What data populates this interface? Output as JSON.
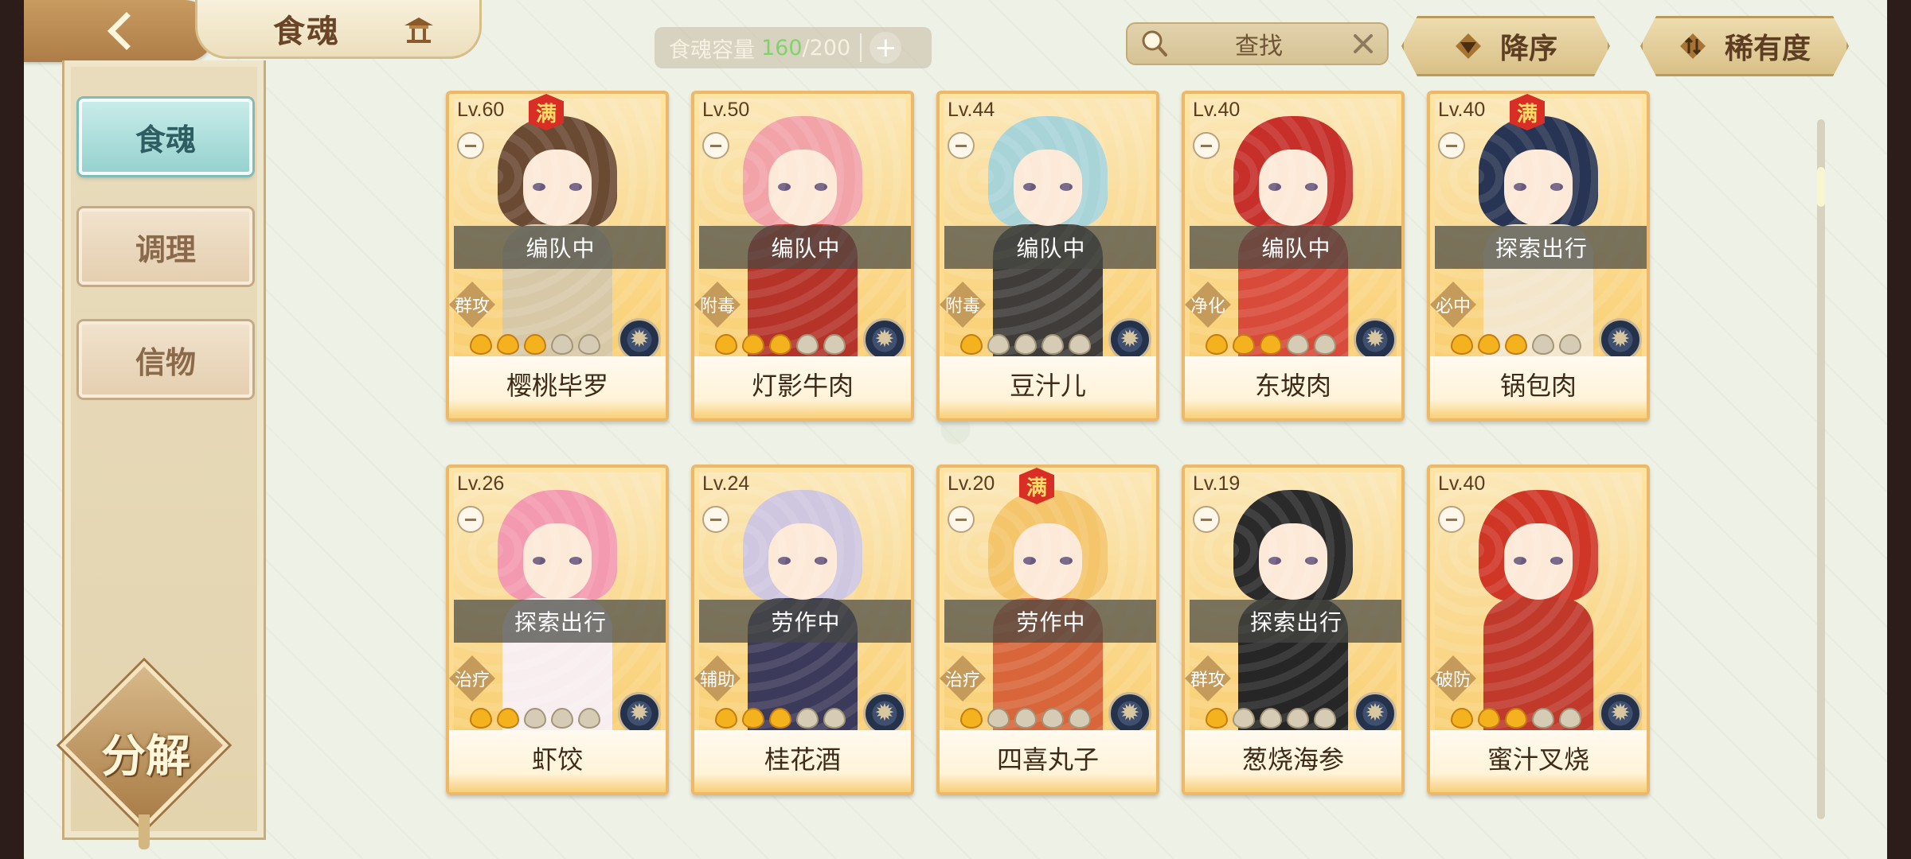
{
  "header": {
    "title": "食魂",
    "capacity_label": "食魂容量",
    "capacity_current": "160",
    "capacity_max": "/200",
    "capacity_add": "+",
    "search_text": "查找",
    "search_clear": "✕",
    "sort_order_label": "降序",
    "sort_type_label": "稀有度"
  },
  "sidebar": {
    "tabs": [
      {
        "label": "食魂",
        "active": true
      },
      {
        "label": "调理",
        "active": false
      },
      {
        "label": "信物",
        "active": false
      }
    ],
    "decompose_label": "分解"
  },
  "cards": [
    {
      "level": "Lv.60",
      "max": "满",
      "status": "编队中",
      "role": "群攻",
      "stars": 3,
      "name": "樱桃毕罗",
      "hair": "#6b4a33",
      "outfit": "#d7c8a8"
    },
    {
      "level": "Lv.50",
      "max": "",
      "status": "编队中",
      "role": "附毒",
      "stars": 3,
      "name": "灯影牛肉",
      "hair": "#f2a3a8",
      "outfit": "#b6332a"
    },
    {
      "level": "Lv.44",
      "max": "",
      "status": "编队中",
      "role": "附毒",
      "stars": 1,
      "name": "豆汁儿",
      "hair": "#a8d4d8",
      "outfit": "#3f3c3a"
    },
    {
      "level": "Lv.40",
      "max": "",
      "status": "编队中",
      "role": "净化",
      "stars": 3,
      "name": "东坡肉",
      "hair": "#c62f2a",
      "outfit": "#d84b3a"
    },
    {
      "level": "Lv.40",
      "max": "满",
      "status": "探索出行",
      "role": "必中",
      "stars": 3,
      "name": "锅包肉",
      "hair": "#283453",
      "outfit": "#f3e6cb"
    },
    {
      "level": "Lv.26",
      "max": "",
      "status": "探索出行",
      "role": "治疗",
      "stars": 2,
      "name": "虾饺",
      "hair": "#f49ab0",
      "outfit": "#f8eef0"
    },
    {
      "level": "Lv.24",
      "max": "",
      "status": "劳作中",
      "role": "辅助",
      "stars": 3,
      "name": "桂花酒",
      "hair": "#cfc6e0",
      "outfit": "#3c3a5a"
    },
    {
      "level": "Lv.20",
      "max": "满",
      "status": "劳作中",
      "role": "治疗",
      "stars": 1,
      "name": "四喜丸子",
      "hair": "#f4c56a",
      "outfit": "#d8663a"
    },
    {
      "level": "Lv.19",
      "max": "",
      "status": "探索出行",
      "role": "群攻",
      "stars": 1,
      "name": "葱烧海参",
      "hair": "#2b2a2a",
      "outfit": "#262626"
    },
    {
      "level": "Lv.40",
      "max": "",
      "status": "",
      "role": "破防",
      "stars": 3,
      "name": "蜜汁叉烧",
      "hair": "#cf3626",
      "outfit": "#c0392b"
    }
  ]
}
